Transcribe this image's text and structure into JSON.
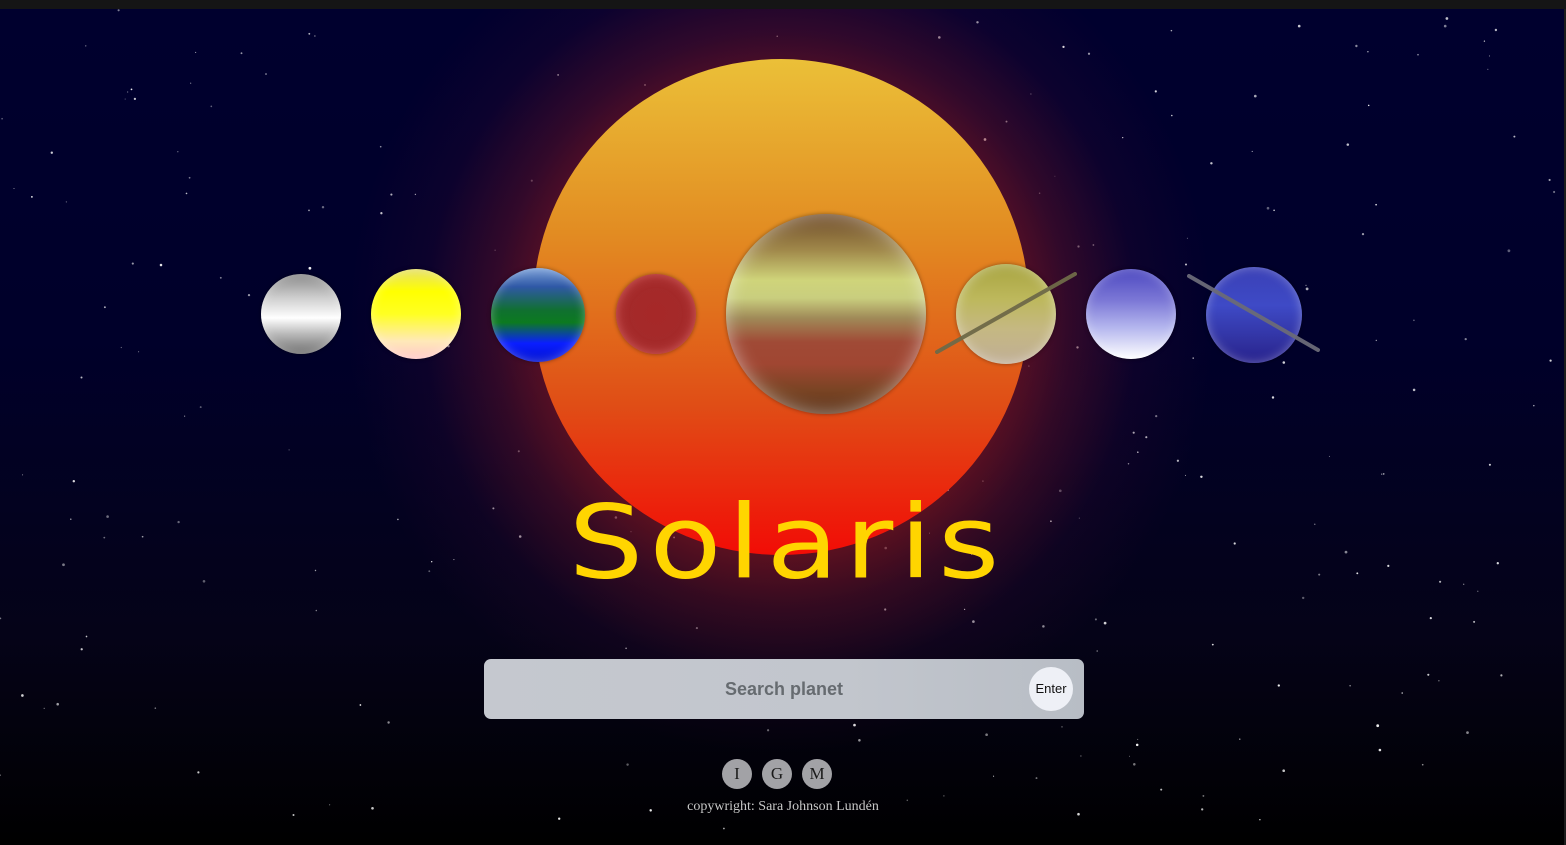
{
  "site": {
    "title": "Solaris"
  },
  "planets": [
    {
      "name": "mercury",
      "colors": [
        "#888888",
        "#ffffff",
        "#6d6d6d"
      ]
    },
    {
      "name": "venus",
      "colors": [
        "#ffff00",
        "#ffc8c8"
      ]
    },
    {
      "name": "earth",
      "colors": [
        "#2f58a6",
        "#0c7a20",
        "#0a1eff"
      ]
    },
    {
      "name": "mars",
      "colors": [
        "#a42a2a"
      ]
    },
    {
      "name": "jupiter",
      "colors": [
        "#6e4a28",
        "#cfd47a",
        "#a04632",
        "#5a3218"
      ]
    },
    {
      "name": "saturn",
      "colors": [
        "#a8a440",
        "#c0ae96"
      ],
      "has_ring": true
    },
    {
      "name": "uranus",
      "colors": [
        "#4c48c0",
        "#ffffff"
      ]
    },
    {
      "name": "neptune",
      "colors": [
        "#3a40b6",
        "#26208c"
      ],
      "has_ring": true
    }
  ],
  "sun": {
    "colors": [
      "#ebc038",
      "#e28c22",
      "#f20c06"
    ]
  },
  "search": {
    "placeholder": "Search planet",
    "value": "",
    "button_label": "Enter"
  },
  "social": {
    "links": [
      {
        "label": "I"
      },
      {
        "label": "G"
      },
      {
        "label": "M"
      }
    ]
  },
  "footer": {
    "copyright": "copywright: Sara Johnson Lundén"
  },
  "theme": {
    "title_color": "#ffd500",
    "background": "#00002e"
  }
}
